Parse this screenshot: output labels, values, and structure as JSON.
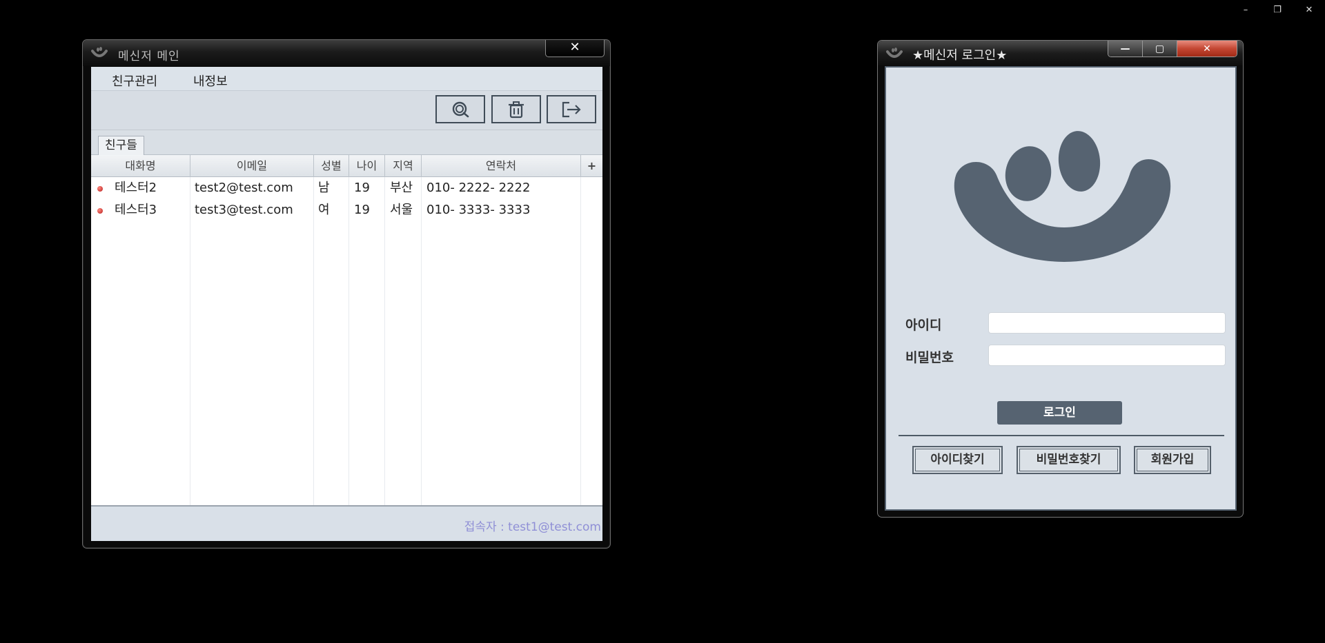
{
  "host": {
    "minimize": "–",
    "restore": "❐",
    "close": "✕"
  },
  "main_window": {
    "title": "메신저 메인",
    "close_label": "✕",
    "menu": [
      "친구관리",
      "내정보"
    ],
    "toolbar": {
      "search_icon": "search-icon",
      "delete_icon": "trash-icon",
      "logout_icon": "logout-icon"
    },
    "tab": "친구들",
    "columns": [
      "대화명",
      "이메일",
      "성별",
      "나이",
      "지역",
      "연락처"
    ],
    "corner": "+",
    "rows": [
      {
        "name": "테스터2",
        "email": "test2@test.com",
        "gender": "남",
        "age": "19",
        "region": "부산",
        "phone": "010- 2222- 2222"
      },
      {
        "name": "테스터3",
        "email": "test3@test.com",
        "gender": "여",
        "age": "19",
        "region": "서울",
        "phone": "010- 3333- 3333"
      }
    ],
    "status": "접속자 : test1@test.com"
  },
  "login_window": {
    "title": "★메신저 로그인★",
    "caption": {
      "minimize": "—",
      "maximize": "▢",
      "close": "✕"
    },
    "logo": "smiley-logo",
    "id_label": "아이디",
    "id_value": "",
    "pw_label": "비밀번호",
    "pw_value": "",
    "login_button": "로그인",
    "find_id_button": "아이디찾기",
    "find_pw_button": "비밀번호찾기",
    "signup_button": "회원가입"
  },
  "colors": {
    "logo": "#566371",
    "window_bg": "#d9e0e8",
    "status_text": "#8f8fd6",
    "close_red": "#c44733"
  }
}
